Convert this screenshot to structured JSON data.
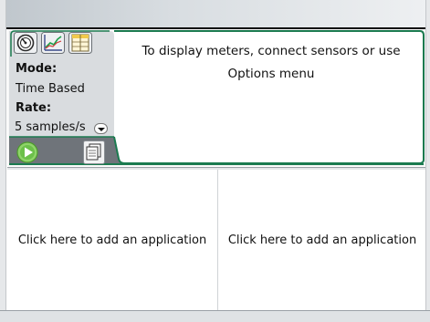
{
  "icons": {
    "meter_tab": "meter-gauge-icon",
    "graph_tab": "graph-icon",
    "table_tab": "table-icon",
    "collect": "play-icon",
    "new_experiment": "new-experiment-icon"
  },
  "colors": {
    "panel_border": "#1a7a4f",
    "collect_green": "#6cc04a",
    "graph_line": "#1b9f49"
  },
  "dataquest": {
    "mode_label": "Mode:",
    "mode_value": "Time Based",
    "rate_label": "Rate:",
    "rate_value": "5 samples/s",
    "message": "To display meters, connect sensors or use Options menu"
  },
  "panes": {
    "left_prompt": "Click here to add an application",
    "right_prompt": "Click here to add an application"
  }
}
